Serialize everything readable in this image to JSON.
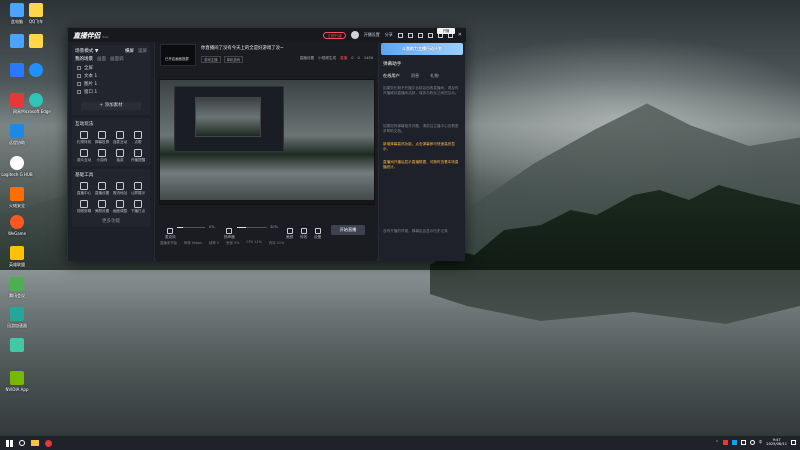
{
  "desktop": {
    "icons": [
      {
        "label": "此电脑",
        "color": "#4aa3ff"
      },
      {
        "label": "QQ飞车",
        "color": "#ffd64a"
      },
      {
        "label": "",
        "color": "#4aa3ff"
      },
      {
        "label": "",
        "color": "#ffd64a"
      },
      {
        "label": "",
        "color": "#2979ff"
      },
      {
        "label": "",
        "color": "#1e90ff"
      },
      {
        "label": "网易",
        "color": "#e53935"
      },
      {
        "label": "Microsoft Edge",
        "color": "#2ec4b6"
      },
      {
        "label": "远程协助",
        "color": "#1e88e5"
      },
      {
        "label": "Logitech G HUB",
        "color": "#ffffff"
      },
      {
        "label": "火绒安全",
        "color": "#ff6d00"
      },
      {
        "label": "WeGame",
        "color": "#ff5722"
      },
      {
        "label": "英雄联盟",
        "color": "#ffc107"
      },
      {
        "label": "腾讯会议",
        "color": "#4caf50"
      },
      {
        "label": "迅游加速器",
        "color": "#26a69a"
      },
      {
        "label": "NVIDIA App",
        "color": "#76b900"
      }
    ]
  },
  "app": {
    "logo": "直播伴侣",
    "version": "Beta",
    "topbar": {
      "upgrade": "立即升级",
      "right_items": [
        "开播设置",
        "分享"
      ]
    },
    "left": {
      "scene_title": "场景模式 ▼",
      "scene_tabs": [
        "横屏",
        "竖屏"
      ],
      "source_tabs": [
        "我的场景",
        "画面",
        "画面调"
      ],
      "scenes": [
        "全屏",
        "文本 1",
        "图片 1",
        "窗口 1"
      ],
      "add_source": "+ 添加素材",
      "interact_title": "互动玩法",
      "interact_tools": [
        "礼物特效",
        "弹幕投屏",
        "连麦互动",
        "点歌",
        "观众互动",
        "小游戏",
        "抽奖",
        "开播提醒"
      ],
      "tools_title": "基础工具",
      "basic_tools": [
        "直播中心",
        "直播设置",
        "推流地址",
        "公屏展示",
        "视频剪辑",
        "美颜设置",
        "画面调整",
        "下播打点"
      ],
      "more": "更多功能"
    },
    "center": {
      "thumb_text": "已开启画面投屏",
      "title": "你直播间了没有今天上的全是好游戏了没~",
      "tags": [
        "游戏主播",
        "单机游戏"
      ],
      "right": [
        "直播设置",
        "小视频生成"
      ],
      "live_badge": "直播",
      "stats": [
        "0",
        "0",
        "1456"
      ],
      "controls": {
        "mic_label": "麦克风",
        "mic_pct": "0%",
        "speaker_label": "扬声器",
        "speaker_pct": "30%",
        "beauty": "美颜",
        "effects": "特效",
        "settings": "设置",
        "go_live": "开始直播"
      },
      "status": [
        "直播未开始",
        "码率 0kbps",
        "帧率 0",
        "丢帧 0%",
        "CPU 12%",
        "内存 41%",
        "直播时长"
      ]
    },
    "right": {
      "banner": "斗鱼助力主播行动计划",
      "title": "弹幕助手",
      "tabs": [
        "在线用户",
        "消息",
        "礼物"
      ],
      "text1": "如果您长期不开播平台将会回收直播间，请及时开播维持直播间活跃，保持与粉丝之间的互动。",
      "text2": "如果您有弹幕相关问题，请前往主播中心查看更多帮助文档。",
      "highlight": "新增弹幕高亮功能，点击弹幕即可快速高亮显示。",
      "text3": "直播间开播后显示直播数据，可随时查看本场直播统计。",
      "tip": "没有开播的时候，弹幕区会显示历史记录"
    }
  },
  "tooltip": "开播",
  "taskbar": {
    "time": "9:47",
    "date": "2025/08/11"
  }
}
